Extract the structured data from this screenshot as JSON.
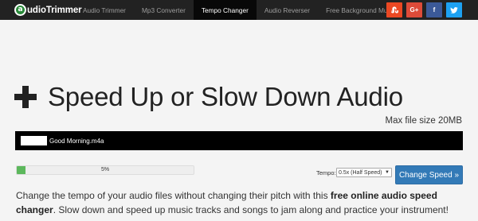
{
  "brand": {
    "logo_mark": "a",
    "name": "udioTrimmer"
  },
  "nav": {
    "tabs": [
      {
        "label": "Audio Trimmer",
        "active": false
      },
      {
        "label": "Mp3 Converter",
        "active": false
      },
      {
        "label": "Tempo Changer",
        "active": true
      },
      {
        "label": "Audio Reverser",
        "active": false
      },
      {
        "label": "Free Background Music",
        "active": false
      }
    ]
  },
  "social": [
    {
      "name": "stumbleupon",
      "icon": "stumbleupon-icon",
      "color": "#eb4823"
    },
    {
      "name": "googleplus",
      "label": "G+",
      "icon": "google-plus-icon",
      "color": "#dd4b39"
    },
    {
      "name": "facebook",
      "label": "f",
      "icon": "facebook-icon",
      "color": "#3b5998"
    },
    {
      "name": "twitter",
      "icon": "twitter-icon",
      "color": "#1da1f2"
    }
  ],
  "main": {
    "title": "Speed Up or Slow Down Audio",
    "max_file_size": "Max file size 20MB",
    "file_name": "Good Morning.m4a",
    "progress": {
      "label": "5%",
      "percent": 5
    },
    "tempo": {
      "label": "Tempo:",
      "selected": "0.5x (Half Speed)"
    },
    "change_button": "Change Speed »",
    "description_before": "Change the tempo of your audio files without changing their pitch with this ",
    "description_bold": "free online audio speed changer",
    "description_after": ". Slow down and speed up music tracks and songs to jam along and practice your instrument!"
  },
  "colors": {
    "navbar": "#222222",
    "progress": "#5cb85c",
    "button": "#337ab7"
  }
}
